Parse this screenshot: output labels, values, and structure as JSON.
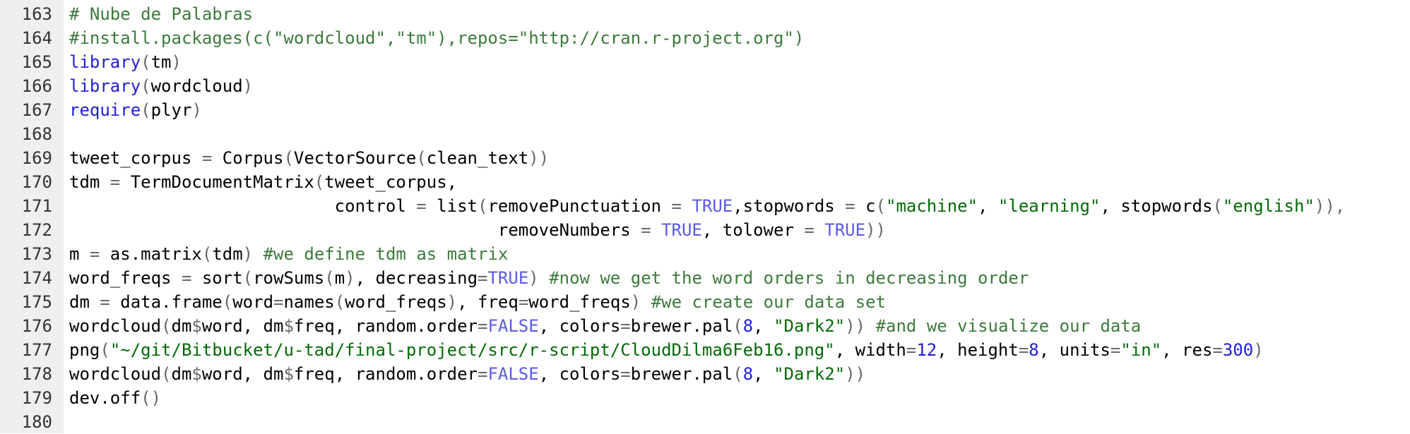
{
  "editor": {
    "colors": {
      "gutter_bg": "#efefef",
      "comment": "#3c7a3c",
      "keyword": "#1f1fd6",
      "string": "#036a07",
      "number": "#1f1fd6",
      "constant": "#5a5ae6",
      "operator": "#686868"
    },
    "lines": [
      {
        "number": "163",
        "tokens": [
          {
            "t": "comment",
            "v": "# Nube de Palabras"
          }
        ]
      },
      {
        "number": "164",
        "tokens": [
          {
            "t": "comment",
            "v": "#install.packages(c(\"wordcloud\",\"tm\"),repos=\"http://cran.r-project.org\")"
          }
        ]
      },
      {
        "number": "165",
        "tokens": [
          {
            "t": "keyword",
            "v": "library"
          },
          {
            "t": "op",
            "v": "("
          },
          {
            "t": "plain",
            "v": "tm"
          },
          {
            "t": "op",
            "v": ")"
          }
        ]
      },
      {
        "number": "166",
        "tokens": [
          {
            "t": "keyword",
            "v": "library"
          },
          {
            "t": "op",
            "v": "("
          },
          {
            "t": "plain",
            "v": "wordcloud"
          },
          {
            "t": "op",
            "v": ")"
          }
        ]
      },
      {
        "number": "167",
        "tokens": [
          {
            "t": "keyword",
            "v": "require"
          },
          {
            "t": "op",
            "v": "("
          },
          {
            "t": "plain",
            "v": "plyr"
          },
          {
            "t": "op",
            "v": ")"
          }
        ]
      },
      {
        "number": "168",
        "tokens": []
      },
      {
        "number": "169",
        "tokens": [
          {
            "t": "plain",
            "v": "tweet_corpus "
          },
          {
            "t": "op",
            "v": "="
          },
          {
            "t": "plain",
            "v": " Corpus"
          },
          {
            "t": "op",
            "v": "("
          },
          {
            "t": "plain",
            "v": "VectorSource"
          },
          {
            "t": "op",
            "v": "("
          },
          {
            "t": "plain",
            "v": "clean_text"
          },
          {
            "t": "op",
            "v": "))"
          }
        ]
      },
      {
        "number": "170",
        "tokens": [
          {
            "t": "plain",
            "v": "tdm "
          },
          {
            "t": "op",
            "v": "="
          },
          {
            "t": "plain",
            "v": " TermDocumentMatrix"
          },
          {
            "t": "op",
            "v": "("
          },
          {
            "t": "plain",
            "v": "tweet_corpus,"
          }
        ]
      },
      {
        "number": "171",
        "tokens": [
          {
            "t": "plain",
            "v": "                          control "
          },
          {
            "t": "op",
            "v": "="
          },
          {
            "t": "plain",
            "v": " list"
          },
          {
            "t": "op",
            "v": "("
          },
          {
            "t": "plain",
            "v": "removePunctuation "
          },
          {
            "t": "op",
            "v": "="
          },
          {
            "t": "plain",
            "v": " "
          },
          {
            "t": "const",
            "v": "TRUE"
          },
          {
            "t": "plain",
            "v": ",stopwords "
          },
          {
            "t": "op",
            "v": "="
          },
          {
            "t": "plain",
            "v": " c"
          },
          {
            "t": "op",
            "v": "("
          },
          {
            "t": "string",
            "v": "\"machine\""
          },
          {
            "t": "plain",
            "v": ", "
          },
          {
            "t": "string",
            "v": "\"learning\""
          },
          {
            "t": "plain",
            "v": ", stopwords"
          },
          {
            "t": "op",
            "v": "("
          },
          {
            "t": "string",
            "v": "\"english\""
          },
          {
            "t": "op",
            "v": ")),"
          }
        ]
      },
      {
        "number": "172",
        "tokens": [
          {
            "t": "plain",
            "v": "                                          removeNumbers "
          },
          {
            "t": "op",
            "v": "="
          },
          {
            "t": "plain",
            "v": " "
          },
          {
            "t": "const",
            "v": "TRUE"
          },
          {
            "t": "plain",
            "v": ", tolower "
          },
          {
            "t": "op",
            "v": "="
          },
          {
            "t": "plain",
            "v": " "
          },
          {
            "t": "const",
            "v": "TRUE"
          },
          {
            "t": "op",
            "v": "))"
          }
        ]
      },
      {
        "number": "173",
        "tokens": [
          {
            "t": "plain",
            "v": "m "
          },
          {
            "t": "op",
            "v": "="
          },
          {
            "t": "plain",
            "v": " as.matrix"
          },
          {
            "t": "op",
            "v": "("
          },
          {
            "t": "plain",
            "v": "tdm"
          },
          {
            "t": "op",
            "v": ")"
          },
          {
            "t": "plain",
            "v": " "
          },
          {
            "t": "comment",
            "v": "#we define tdm as matrix"
          }
        ]
      },
      {
        "number": "174",
        "tokens": [
          {
            "t": "plain",
            "v": "word_freqs "
          },
          {
            "t": "op",
            "v": "="
          },
          {
            "t": "plain",
            "v": " sort"
          },
          {
            "t": "op",
            "v": "("
          },
          {
            "t": "plain",
            "v": "rowSums"
          },
          {
            "t": "op",
            "v": "("
          },
          {
            "t": "plain",
            "v": "m"
          },
          {
            "t": "op",
            "v": ")"
          },
          {
            "t": "plain",
            "v": ", decreasing"
          },
          {
            "t": "op",
            "v": "="
          },
          {
            "t": "const",
            "v": "TRUE"
          },
          {
            "t": "op",
            "v": ")"
          },
          {
            "t": "plain",
            "v": " "
          },
          {
            "t": "comment",
            "v": "#now we get the word orders in decreasing order"
          }
        ]
      },
      {
        "number": "175",
        "tokens": [
          {
            "t": "plain",
            "v": "dm "
          },
          {
            "t": "op",
            "v": "="
          },
          {
            "t": "plain",
            "v": " data.frame"
          },
          {
            "t": "op",
            "v": "("
          },
          {
            "t": "plain",
            "v": "word"
          },
          {
            "t": "op",
            "v": "="
          },
          {
            "t": "plain",
            "v": "names"
          },
          {
            "t": "op",
            "v": "("
          },
          {
            "t": "plain",
            "v": "word_freqs"
          },
          {
            "t": "op",
            "v": ")"
          },
          {
            "t": "plain",
            "v": ", freq"
          },
          {
            "t": "op",
            "v": "="
          },
          {
            "t": "plain",
            "v": "word_freqs"
          },
          {
            "t": "op",
            "v": ")"
          },
          {
            "t": "plain",
            "v": " "
          },
          {
            "t": "comment",
            "v": "#we create our data set"
          }
        ]
      },
      {
        "number": "176",
        "tokens": [
          {
            "t": "plain",
            "v": "wordcloud"
          },
          {
            "t": "op",
            "v": "("
          },
          {
            "t": "plain",
            "v": "dm"
          },
          {
            "t": "op",
            "v": "$"
          },
          {
            "t": "plain",
            "v": "word, dm"
          },
          {
            "t": "op",
            "v": "$"
          },
          {
            "t": "plain",
            "v": "freq, random.order"
          },
          {
            "t": "op",
            "v": "="
          },
          {
            "t": "const",
            "v": "FALSE"
          },
          {
            "t": "plain",
            "v": ", colors"
          },
          {
            "t": "op",
            "v": "="
          },
          {
            "t": "plain",
            "v": "brewer.pal"
          },
          {
            "t": "op",
            "v": "("
          },
          {
            "t": "number",
            "v": "8"
          },
          {
            "t": "plain",
            "v": ", "
          },
          {
            "t": "string",
            "v": "\"Dark2\""
          },
          {
            "t": "op",
            "v": "))"
          },
          {
            "t": "plain",
            "v": " "
          },
          {
            "t": "comment",
            "v": "#and we visualize our data"
          }
        ]
      },
      {
        "number": "177",
        "tokens": [
          {
            "t": "plain",
            "v": "png"
          },
          {
            "t": "op",
            "v": "("
          },
          {
            "t": "string",
            "v": "\"~/git/Bitbucket/u-tad/final-project/src/r-script/CloudDilma6Feb16.png\""
          },
          {
            "t": "plain",
            "v": ", width"
          },
          {
            "t": "op",
            "v": "="
          },
          {
            "t": "number",
            "v": "12"
          },
          {
            "t": "plain",
            "v": ", height"
          },
          {
            "t": "op",
            "v": "="
          },
          {
            "t": "number",
            "v": "8"
          },
          {
            "t": "plain",
            "v": ", units"
          },
          {
            "t": "op",
            "v": "="
          },
          {
            "t": "string",
            "v": "\"in\""
          },
          {
            "t": "plain",
            "v": ", res"
          },
          {
            "t": "op",
            "v": "="
          },
          {
            "t": "number",
            "v": "300"
          },
          {
            "t": "op",
            "v": ")"
          }
        ]
      },
      {
        "number": "178",
        "tokens": [
          {
            "t": "plain",
            "v": "wordcloud"
          },
          {
            "t": "op",
            "v": "("
          },
          {
            "t": "plain",
            "v": "dm"
          },
          {
            "t": "op",
            "v": "$"
          },
          {
            "t": "plain",
            "v": "word, dm"
          },
          {
            "t": "op",
            "v": "$"
          },
          {
            "t": "plain",
            "v": "freq, random.order"
          },
          {
            "t": "op",
            "v": "="
          },
          {
            "t": "const",
            "v": "FALSE"
          },
          {
            "t": "plain",
            "v": ", colors"
          },
          {
            "t": "op",
            "v": "="
          },
          {
            "t": "plain",
            "v": "brewer.pal"
          },
          {
            "t": "op",
            "v": "("
          },
          {
            "t": "number",
            "v": "8"
          },
          {
            "t": "plain",
            "v": ", "
          },
          {
            "t": "string",
            "v": "\"Dark2\""
          },
          {
            "t": "op",
            "v": "))"
          }
        ]
      },
      {
        "number": "179",
        "tokens": [
          {
            "t": "plain",
            "v": "dev.off"
          },
          {
            "t": "op",
            "v": "()"
          }
        ]
      },
      {
        "number": "180",
        "tokens": []
      }
    ]
  }
}
